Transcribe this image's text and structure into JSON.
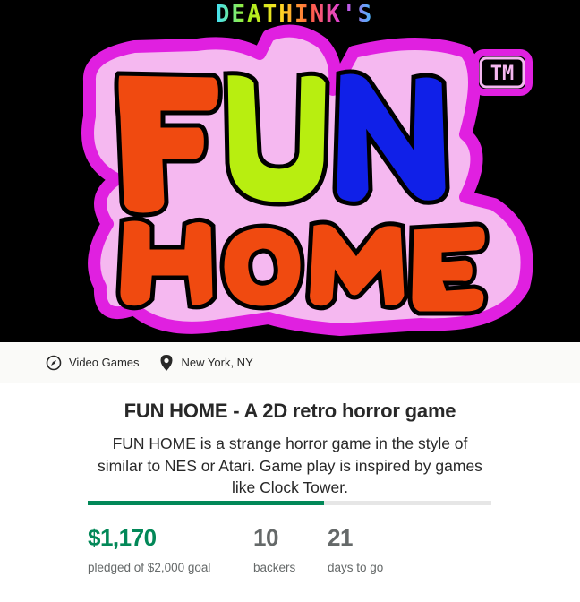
{
  "hero": {
    "studio_text": "DEATHINK'S",
    "logo_line1": [
      "F",
      "U",
      "N"
    ],
    "logo_line2": "HOME",
    "trademark": "TM",
    "colors": {
      "background": "#000000",
      "outline": "#e020e0",
      "inner_outline": "#f5b8f0",
      "f": "#f04a10",
      "u": "#b8ee10",
      "n": "#1020e8",
      "home": "#f04a10"
    }
  },
  "meta": {
    "category": {
      "label": "Video Games",
      "icon": "compass-icon"
    },
    "location": {
      "label": "New York, NY",
      "icon": "location-pin-icon"
    }
  },
  "project": {
    "title": "FUN HOME - A 2D retro horror game",
    "blurb": "FUN HOME is a strange horror game in the style of similar to NES or Atari. Game play is inspired by games like Clock Tower.",
    "funded_fraction": 0.585,
    "pledged": {
      "value": "$1,170",
      "label": "pledged of $2,000 goal"
    },
    "backers": {
      "value": "10",
      "label": "backers"
    },
    "days": {
      "value": "21",
      "label": "days to go"
    },
    "accent_color": "#028858"
  }
}
